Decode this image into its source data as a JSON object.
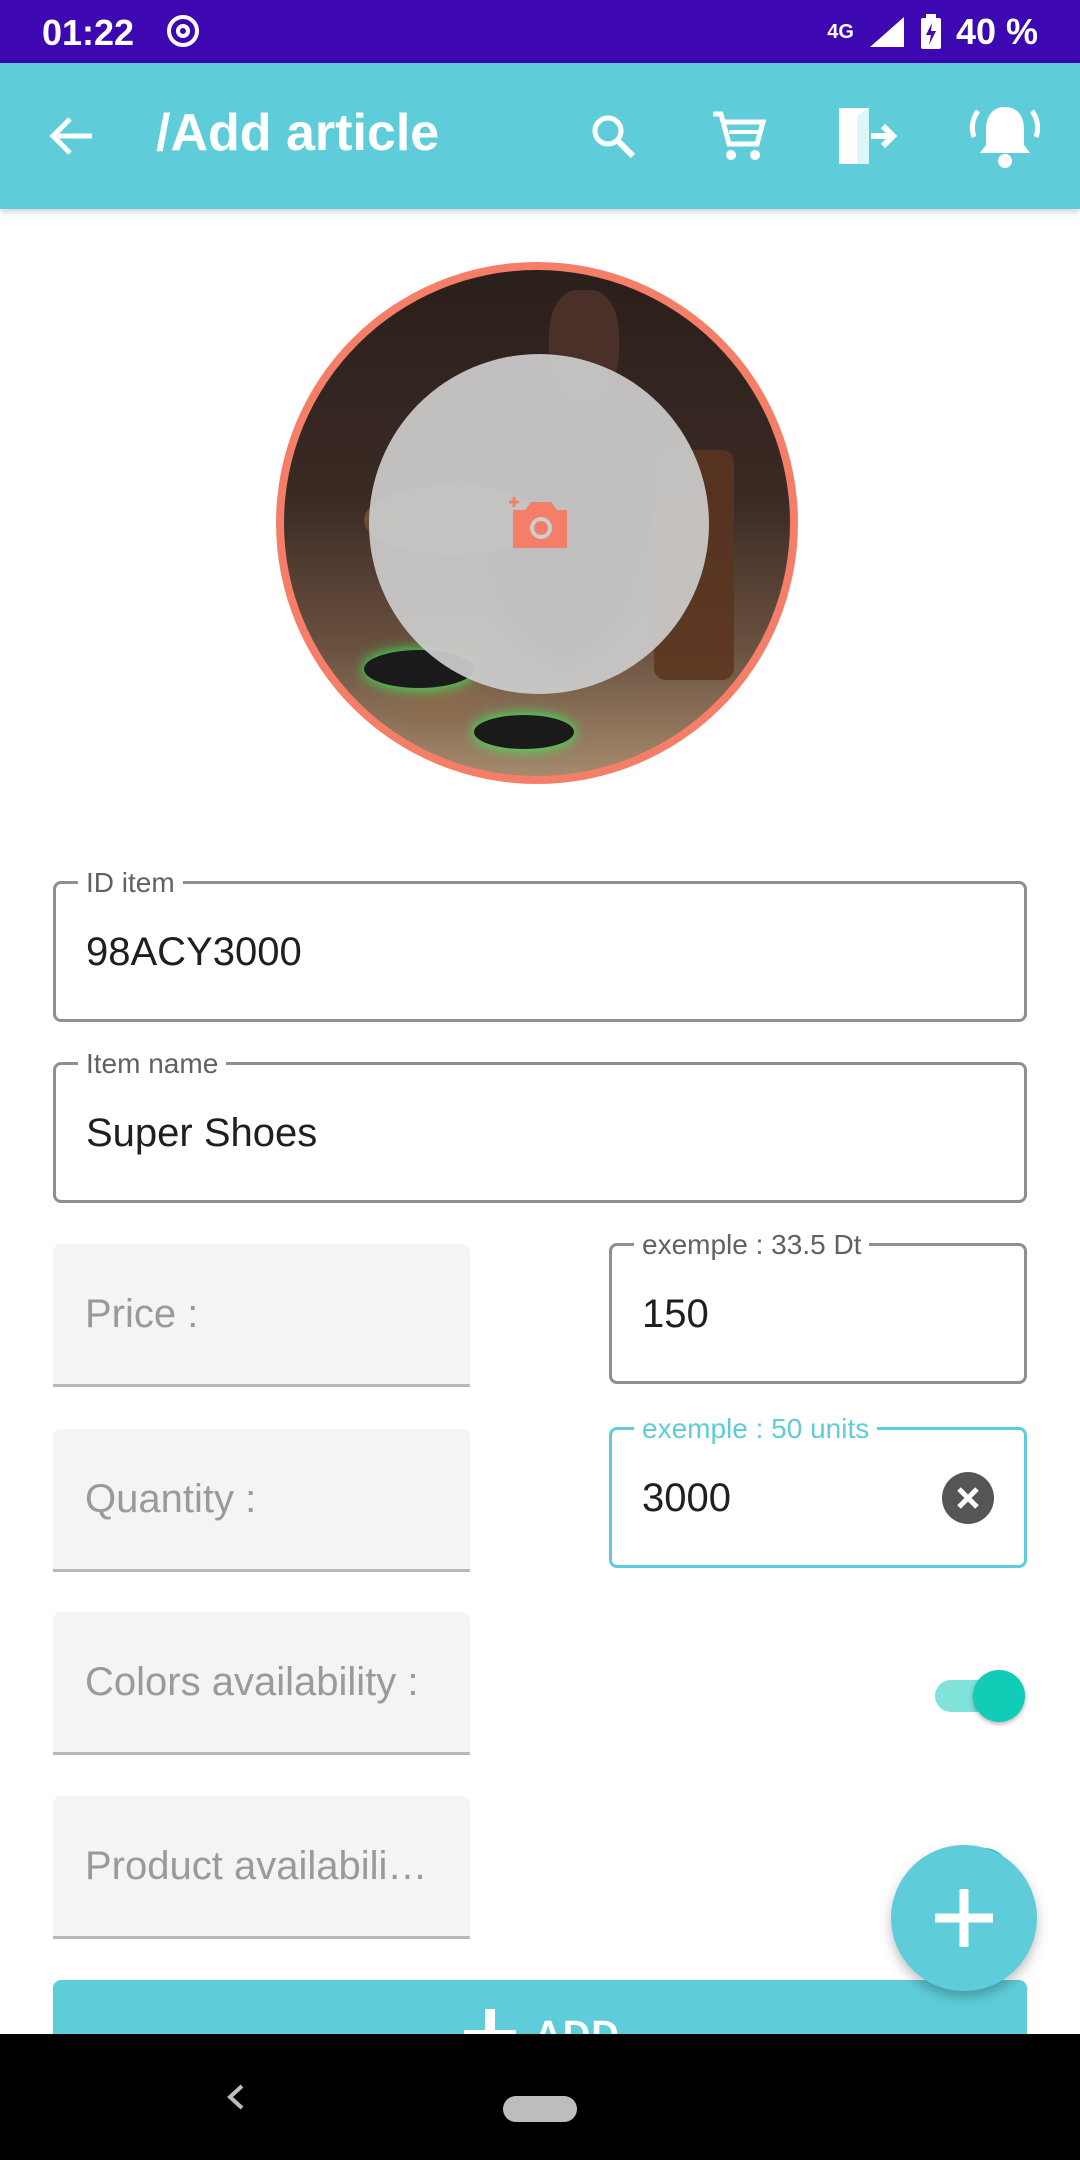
{
  "status_bar": {
    "time": "01:22",
    "network": "4G",
    "battery": "40 %"
  },
  "app_bar": {
    "title": "/Add article",
    "icons": [
      "arrow-back-icon",
      "search-icon",
      "cart-icon",
      "logout-icon",
      "bell-icon"
    ]
  },
  "avatar": {
    "overlay_icon": "camera-add-icon"
  },
  "form": {
    "id_item": {
      "label": "ID item",
      "value": "98ACY3000"
    },
    "item_name": {
      "label": "Item name",
      "value": "Super Shoes"
    },
    "price": {
      "label": "Price :",
      "hint": "exemple : 33.5 Dt",
      "value": "150"
    },
    "quantity": {
      "label": "Quantity :",
      "hint": "exemple : 50 units",
      "value": "3000"
    },
    "colors": {
      "label": "Colors availability :",
      "enabled": true
    },
    "product": {
      "label": "Product availabili…",
      "enabled": true
    }
  },
  "add_button": {
    "label": "ADD"
  },
  "colors": {
    "primary": "#5fcdd9",
    "status_bar": "#3d07b1",
    "accent": "#f47e68",
    "toggle": "#11cdb8"
  }
}
